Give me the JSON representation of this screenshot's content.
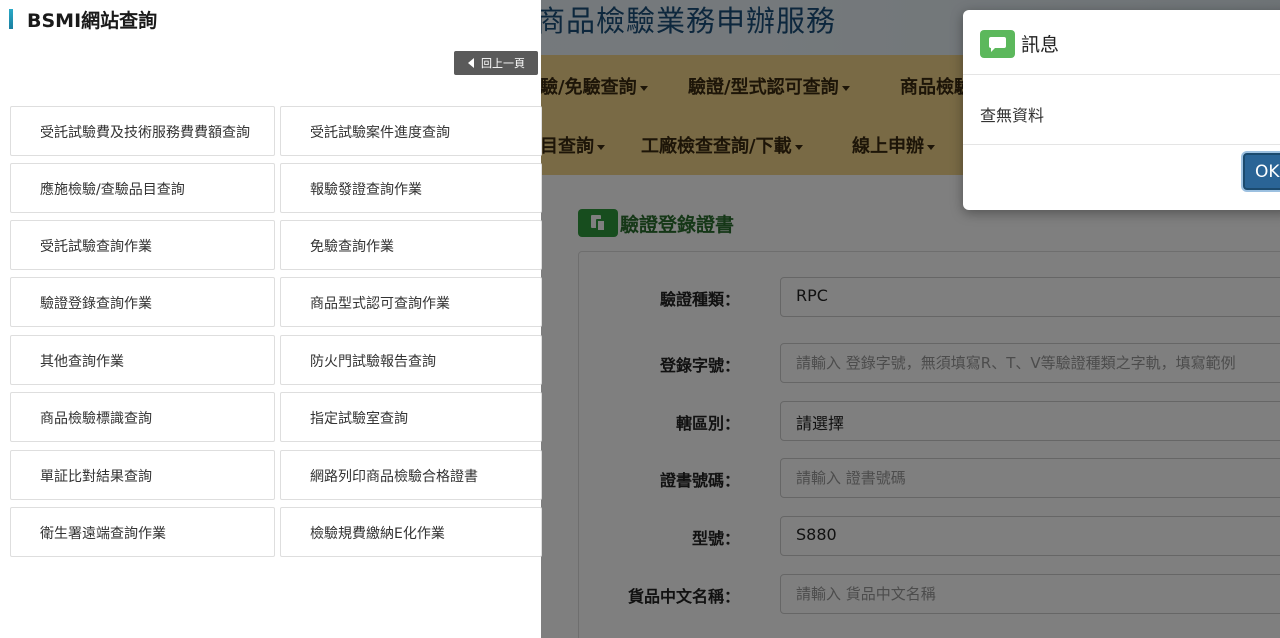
{
  "background": {
    "banner_title": "商品檢驗業務申辦服務",
    "nav_row1": [
      "驗/免驗查詢",
      "驗證/型式認可查詢",
      "商品檢驗"
    ],
    "nav_row2": [
      "目查詢",
      "工廠檢查查詢/下載",
      "線上申辦"
    ],
    "section_title": "驗證登錄證書",
    "form": [
      {
        "label": "驗證種類：",
        "value": "RPC",
        "placeholder": ""
      },
      {
        "label": "登錄字號：",
        "value": "",
        "placeholder": "請輸入 登錄字號，無須填寫R、T、V等驗證種類之字軌，填寫範例"
      },
      {
        "label": "轄區別：",
        "value": "請選擇",
        "placeholder": ""
      },
      {
        "label": "證書號碼：",
        "value": "",
        "placeholder": "請輸入 證書號碼"
      },
      {
        "label": "型號：",
        "value": "S880",
        "placeholder": ""
      },
      {
        "label": "貨品中文名稱：",
        "value": "",
        "placeholder": "請輸入 貨品中文名稱"
      }
    ]
  },
  "sidepanel": {
    "title": "BSMI網站查詢",
    "back_label": "回上一頁",
    "items": [
      [
        "受託試驗費及技術服務費費額查詢",
        "受託試驗案件進度查詢"
      ],
      [
        "應施檢驗/查驗品目查詢",
        "報驗發證查詢作業"
      ],
      [
        "受託試驗查詢作業",
        "免驗查詢作業"
      ],
      [
        "驗證登錄查詢作業",
        "商品型式認可查詢作業"
      ],
      [
        "其他查詢作業",
        "防火門試驗報告查詢"
      ],
      [
        "商品檢驗標識查詢",
        "指定試驗室查詢"
      ],
      [
        "單証比對結果查詢",
        "網路列印商品檢驗合格證書"
      ],
      [
        "衛生署遠端查詢作業",
        "檢驗規費繳納E化作業"
      ]
    ]
  },
  "modal": {
    "title": "訊息",
    "message": "查無資料",
    "ok_label": "OK",
    "icon": "message-icon",
    "accent_color": "#5cb85c"
  }
}
